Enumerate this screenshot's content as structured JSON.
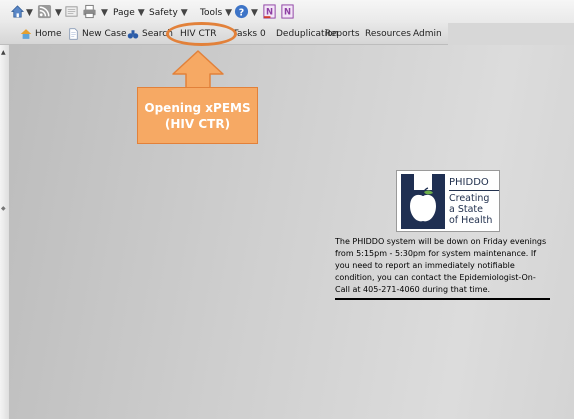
{
  "toolbar": {
    "page_label": "Page",
    "safety_label": "Safety",
    "tools_label": "Tools",
    "icons": [
      "home-icon",
      "feeds-icon",
      "mail-icon",
      "print-icon",
      "help-icon",
      "onenote-icon",
      "onenote-linked-icon"
    ]
  },
  "nav": {
    "items": [
      {
        "id": "home",
        "label": "Home",
        "icon": "home-icon"
      },
      {
        "id": "new-case",
        "label": "New Case",
        "icon": "document-icon"
      },
      {
        "id": "search",
        "label": "Search",
        "icon": "binoculars-icon"
      },
      {
        "id": "hiv-ctr",
        "label": "HIV CTR"
      },
      {
        "id": "tasks",
        "label": "Tasks 0"
      },
      {
        "id": "deduplication",
        "label": "Deduplication"
      },
      {
        "id": "reports",
        "label": "Reports"
      },
      {
        "id": "resources",
        "label": "Resources"
      },
      {
        "id": "admin",
        "label": "Admin"
      }
    ]
  },
  "callout": {
    "line1": "Opening xPEMS",
    "line2": "(HIV CTR)",
    "color": "#f6a964",
    "border_color": "#e2813a"
  },
  "logo": {
    "line1": "PHIDDO",
    "line2": "Creating",
    "line3": "a State",
    "line4": "of Health",
    "color": "#23324f"
  },
  "notice": {
    "text": "The PHIDDO system will be down on Friday evenings from 5:15pm - 5:30pm for system maintenance. If you need to report an immediately notifiable condition, you can contact the Epidemiologist-On-Call at 405-271-4060 during that time."
  }
}
